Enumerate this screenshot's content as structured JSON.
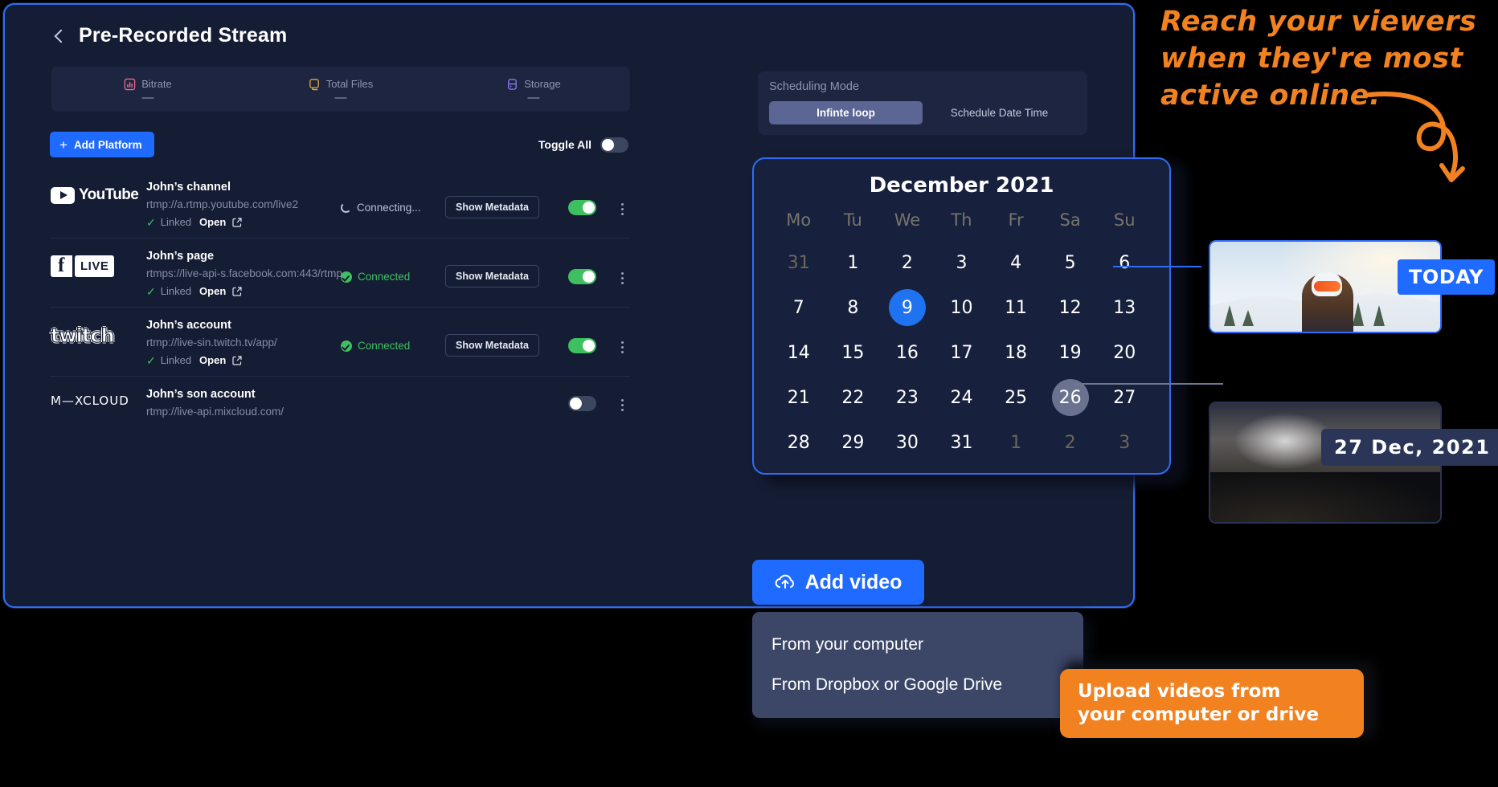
{
  "header": {
    "title": "Pre-Recorded Stream",
    "back_icon": "chevron-left-icon"
  },
  "stats": [
    {
      "label": "Bitrate",
      "value": "—",
      "icon": "bitrate-icon",
      "color": "#e36f8f"
    },
    {
      "label": "Total Files",
      "value": "—",
      "icon": "files-icon",
      "color": "#e8a93c"
    },
    {
      "label": "Storage",
      "value": "—",
      "icon": "storage-icon",
      "color": "#8a7bf0"
    }
  ],
  "toolbar": {
    "add_platform_label": "Add Platform",
    "plus_icon": "plus-icon",
    "toggle_all_label": "Toggle All",
    "toggle_all_state": "off"
  },
  "platforms": [
    {
      "logo": "youtube-logo",
      "logo_text": "YouTube",
      "name": "John’s channel",
      "url": "rtmp://a.rtmp.youtube.com/live2",
      "linked_label": "Linked",
      "open_label": "Open",
      "status": "Connecting...",
      "status_type": "connecting",
      "metadata_label": "Show Metadata",
      "toggle": "on",
      "has_link_row": true
    },
    {
      "logo": "facebook-live-logo",
      "logo_text": "LIVE",
      "name": "John’s page",
      "url": "rtmps://live-api-s.facebook.com:443/rtmp",
      "linked_label": "Linked",
      "open_label": "Open",
      "status": "Connected",
      "status_type": "connected",
      "metadata_label": "Show Metadata",
      "toggle": "on",
      "has_link_row": true
    },
    {
      "logo": "twitch-logo",
      "logo_text": "twitch",
      "name": "John’s account",
      "url": "rtmp://live-sin.twitch.tv/app/",
      "linked_label": "Linked",
      "open_label": "Open",
      "status": "Connected",
      "status_type": "connected",
      "metadata_label": "Show Metadata",
      "toggle": "on",
      "has_link_row": true
    },
    {
      "logo": "mixcloud-logo",
      "logo_text": "M—XCLOUD",
      "name": "John’s son account",
      "url": "rtmp://live-api.mixcloud.com/",
      "linked_label": "",
      "open_label": "",
      "status": "",
      "status_type": "none",
      "metadata_label": "",
      "toggle": "off",
      "has_link_row": false
    }
  ],
  "scheduling": {
    "title": "Scheduling Mode",
    "options": [
      {
        "label": "Infinte loop",
        "active": true
      },
      {
        "label": "Schedule Date Time",
        "active": false
      }
    ]
  },
  "calendar": {
    "title": "December 2021",
    "weekdays": [
      "Mo",
      "Tu",
      "We",
      "Th",
      "Fr",
      "Sa",
      "Su"
    ],
    "selected_day": 9,
    "hovered_day": 26,
    "weeks": [
      [
        {
          "d": "31",
          "muted": true
        },
        {
          "d": "1"
        },
        {
          "d": "2"
        },
        {
          "d": "3"
        },
        {
          "d": "4"
        },
        {
          "d": "5"
        },
        {
          "d": "6"
        }
      ],
      [
        {
          "d": "7"
        },
        {
          "d": "8"
        },
        {
          "d": "9",
          "selected": true
        },
        {
          "d": "10"
        },
        {
          "d": "11"
        },
        {
          "d": "12"
        },
        {
          "d": "13"
        }
      ],
      [
        {
          "d": "14"
        },
        {
          "d": "15"
        },
        {
          "d": "16"
        },
        {
          "d": "17"
        },
        {
          "d": "18"
        },
        {
          "d": "19"
        },
        {
          "d": "20"
        }
      ],
      [
        {
          "d": "21"
        },
        {
          "d": "22"
        },
        {
          "d": "23"
        },
        {
          "d": "24"
        },
        {
          "d": "25"
        },
        {
          "d": "26",
          "hover": true
        },
        {
          "d": "27"
        }
      ],
      [
        {
          "d": "28"
        },
        {
          "d": "29"
        },
        {
          "d": "30"
        },
        {
          "d": "31"
        },
        {
          "d": "1",
          "muted": true
        },
        {
          "d": "2",
          "muted": true
        },
        {
          "d": "3",
          "muted": true
        }
      ]
    ]
  },
  "add_video": {
    "label": "Add video",
    "icon": "upload-cloud-icon",
    "menu": [
      "From your computer",
      "From Dropbox or Google Drive"
    ]
  },
  "tooltips": {
    "orange_callout": "Upload videos from\nyour computer or drive",
    "handwritten": "Reach your viewers\nwhen they're most\nactive online."
  },
  "thumbnails": [
    {
      "badge": "TODAY",
      "badge_color": "#1f6bff",
      "alt": "skier-photo"
    },
    {
      "badge": "27 Dec, 2021",
      "badge_color": "#2a3558",
      "alt": "concert-crowd-photo"
    }
  ],
  "colors": {
    "accent_blue": "#1f6bff",
    "orange": "#f28120",
    "green": "#3fc060",
    "panel": "#1d2541",
    "card_bg": "#151d35"
  }
}
